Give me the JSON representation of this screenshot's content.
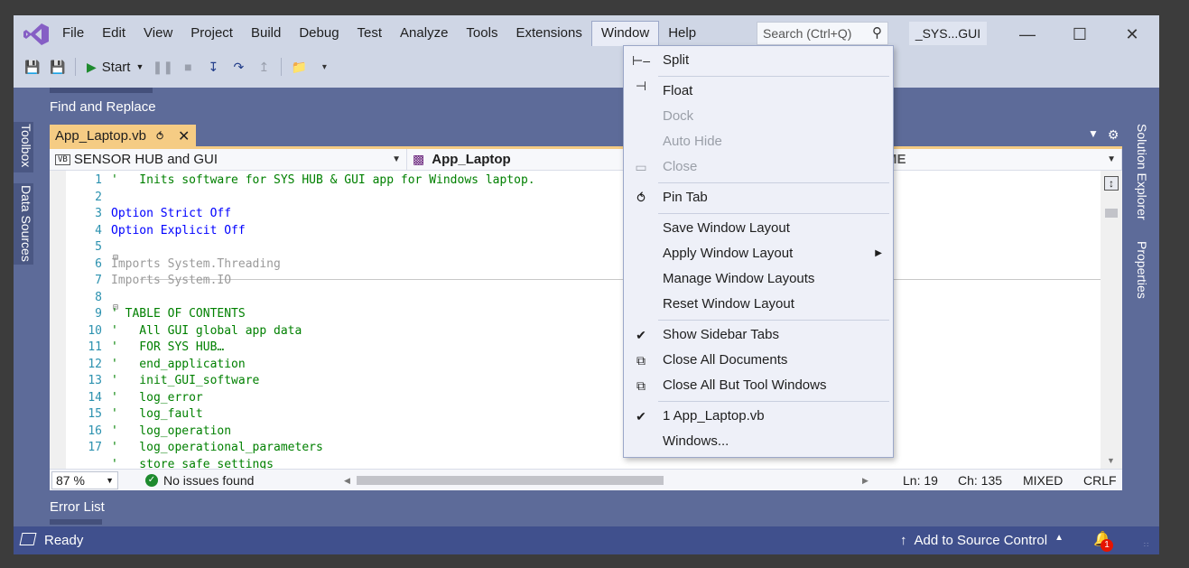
{
  "menu": [
    "File",
    "Edit",
    "View",
    "Project",
    "Build",
    "Debug",
    "Test",
    "Analyze",
    "Tools",
    "Extensions",
    "Window",
    "Help"
  ],
  "search": {
    "placeholder": "Search (Ctrl+Q)"
  },
  "solution_name": "_SYS...GUI",
  "toolbar": {
    "start_label": "Start"
  },
  "panels": {
    "find_replace": "Find and Replace",
    "toolbox": "Toolbox",
    "data_sources": "Data Sources",
    "solution_explorer": "Solution Explorer",
    "properties": "Properties",
    "error_list": "Error List"
  },
  "doc_tab": {
    "title": "App_Laptop.vb"
  },
  "navbar": {
    "project": "SENSOR HUB and GUI",
    "class": "App_Laptop",
    "member": "ME"
  },
  "code_lines": [
    {
      "num": "1",
      "text": "'   Inits software for SYS HUB & GUI app for Windows laptop.",
      "kind": "comment"
    },
    {
      "num": "2",
      "text": "",
      "kind": "plain"
    },
    {
      "num": "3",
      "text": "Option Strict Off",
      "kind": "kw"
    },
    {
      "num": "4",
      "text": "Option Explicit Off",
      "kind": "kw"
    },
    {
      "num": "5",
      "text": "",
      "kind": "plain"
    },
    {
      "num": "6",
      "text": "Imports System.Threading",
      "kind": "dim"
    },
    {
      "num": "7",
      "text": "Imports System.IO",
      "kind": "dim"
    },
    {
      "num": "8",
      "text": "",
      "kind": "plain"
    },
    {
      "num": "9",
      "text": "' TABLE OF CONTENTS",
      "kind": "comment"
    },
    {
      "num": "10",
      "text": "'   All GUI global app data",
      "kind": "comment"
    },
    {
      "num": "11",
      "text": "'   FOR SYS HUB…",
      "kind": "comment"
    },
    {
      "num": "12",
      "text": "'   end_application",
      "kind": "comment"
    },
    {
      "num": "13",
      "text": "'   init_GUI_software",
      "kind": "comment"
    },
    {
      "num": "14",
      "text": "'   log_error",
      "kind": "comment"
    },
    {
      "num": "15",
      "text": "'   log_fault",
      "kind": "comment"
    },
    {
      "num": "16",
      "text": "'   log_operation",
      "kind": "comment"
    },
    {
      "num": "17",
      "text": "'   log_operational_parameters",
      "kind": "comment"
    },
    {
      "num": "",
      "text": "'   store_safe_settings",
      "kind": "comment"
    }
  ],
  "editor_status": {
    "zoom": "87 %",
    "issues": "No issues found",
    "line": "Ln: 19",
    "char": "Ch: 135",
    "mode": "MIXED",
    "eol": "CRLF"
  },
  "statusbar": {
    "ready": "Ready",
    "source_control": "Add to Source Control",
    "notifications": "1"
  },
  "window_menu": [
    {
      "label": "Split",
      "icon": "split-icon",
      "enabled": true
    },
    {
      "label": "Float",
      "icon": "",
      "enabled": true
    },
    {
      "label": "Dock",
      "icon": "",
      "enabled": false
    },
    {
      "label": "Auto Hide",
      "icon": "",
      "enabled": false
    },
    {
      "label": "Close",
      "icon": "window-close-icon",
      "enabled": false
    },
    {
      "label": "Pin Tab",
      "icon": "pin-icon",
      "enabled": true
    },
    {
      "label": "Save Window Layout",
      "icon": "",
      "enabled": true
    },
    {
      "label": "Apply Window Layout",
      "icon": "",
      "enabled": true,
      "submenu": true
    },
    {
      "label": "Manage Window Layouts",
      "icon": "",
      "enabled": true
    },
    {
      "label": "Reset Window Layout",
      "icon": "",
      "enabled": true
    },
    {
      "label": "Show Sidebar Tabs",
      "icon": "check-icon",
      "enabled": true
    },
    {
      "label": "Close All Documents",
      "icon": "close-all-icon",
      "enabled": true
    },
    {
      "label": "Close All But Tool Windows",
      "icon": "close-all-icon",
      "enabled": true
    },
    {
      "label": "1 App_Laptop.vb",
      "icon": "check-icon",
      "enabled": true
    },
    {
      "label": "Windows...",
      "icon": "",
      "enabled": true
    }
  ],
  "colors": {
    "chrome": "#cfd6e5",
    "frame": "#5d6b99",
    "statusbar": "#40508d",
    "active_tab": "#f5cc84",
    "comment": "#008000",
    "keyword": "#0000ff",
    "line_number": "#2b91af"
  }
}
